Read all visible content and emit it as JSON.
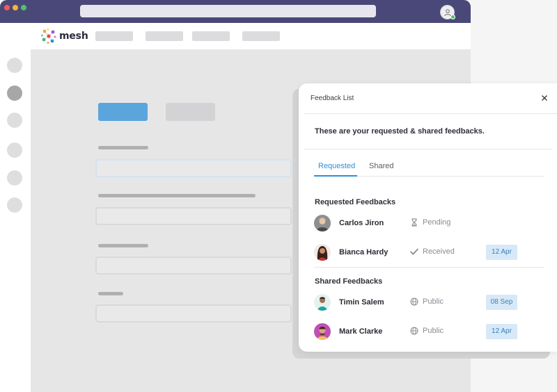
{
  "app": {
    "logo_text": "mesh"
  },
  "feedback_panel": {
    "title": "Feedback List",
    "subtitle": "These are your requested & shared feedbacks.",
    "tabs": [
      {
        "label": "Requested",
        "active": true
      },
      {
        "label": "Shared",
        "active": false
      }
    ],
    "requested": {
      "heading": "Requested Feedbacks",
      "items": [
        {
          "name": "Carlos Jiron",
          "status": "Pending",
          "status_icon": "hourglass-icon",
          "date": ""
        },
        {
          "name": "Bianca Hardy",
          "status": "Received",
          "status_icon": "checkmark-icon",
          "date": "12 Apr"
        }
      ]
    },
    "shared": {
      "heading": "Shared Feedbacks",
      "items": [
        {
          "name": "Timin Salem",
          "status": "Public",
          "status_icon": "globe-icon",
          "date": "08 Sep"
        },
        {
          "name": "Mark Clarke",
          "status": "Public",
          "status_icon": "globe-icon",
          "date": "12 Apr"
        }
      ]
    }
  },
  "colors": {
    "titlebar": "#4a4878",
    "accent": "#2f8fd3",
    "placeholder_button": "#5aa5dc",
    "badge_bg": "#d7e9f8",
    "badge_text": "#3b7fb8"
  }
}
